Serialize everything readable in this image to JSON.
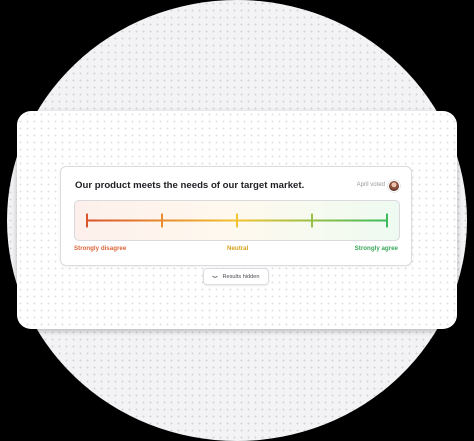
{
  "card": {
    "question": "Our product meets the needs of our target market.",
    "voted_text": "April voted"
  },
  "scale": {
    "left_label": "Strongly disagree",
    "mid_label": "Neutral",
    "right_label": "Strongly agree",
    "points": 5,
    "colors": {
      "start": "#d9532c",
      "mid": "#f2c230",
      "end": "#3dbb5d",
      "left_label": "#d9663a",
      "mid_label": "#d9a21f",
      "right_label": "#3aa65a"
    }
  },
  "results_button": {
    "label": "Results hidden",
    "icon": "eye-closed-icon"
  }
}
